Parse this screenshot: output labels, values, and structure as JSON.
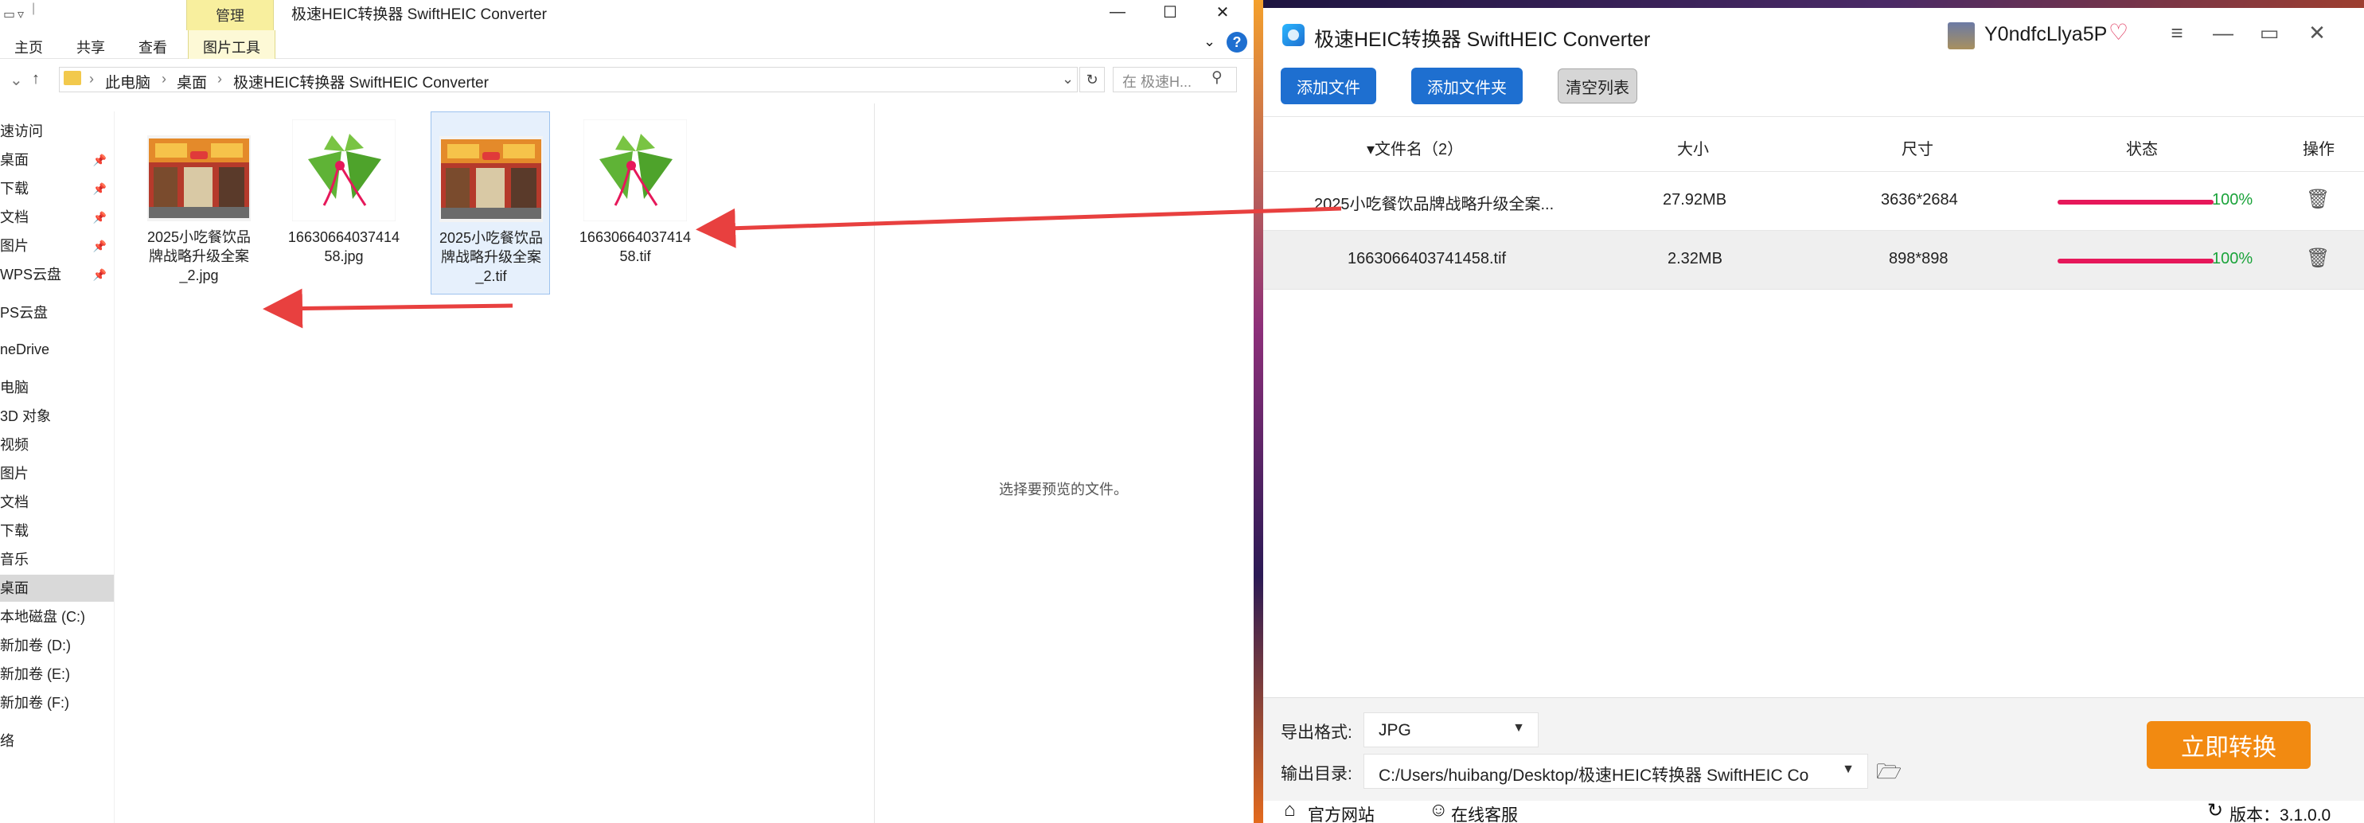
{
  "explorer": {
    "manage_tab": "管理",
    "window_title": "极速HEIC转换器 SwiftHEIC Converter",
    "ribbon_tabs": [
      "主页",
      "共享",
      "查看",
      "图片工具"
    ],
    "breadcrumbs": [
      "此电脑",
      "桌面",
      "极速HEIC转换器 SwiftHEIC Converter"
    ],
    "search_placeholder": "在 极速H...",
    "nav_items": [
      {
        "label": "速访问",
        "pinned": false
      },
      {
        "label": "桌面",
        "pinned": true
      },
      {
        "label": "下载",
        "pinned": true
      },
      {
        "label": "文档",
        "pinned": true
      },
      {
        "label": "图片",
        "pinned": true
      },
      {
        "label": "WPS云盘",
        "pinned": true
      },
      {
        "label": "PS云盘",
        "pinned": false
      },
      {
        "label": "neDrive",
        "pinned": false
      },
      {
        "label": "电脑",
        "pinned": false
      },
      {
        "label": "3D 对象",
        "pinned": false
      },
      {
        "label": "视频",
        "pinned": false
      },
      {
        "label": "图片",
        "pinned": false
      },
      {
        "label": "文档",
        "pinned": false
      },
      {
        "label": "下载",
        "pinned": false
      },
      {
        "label": "音乐",
        "pinned": false
      },
      {
        "label": "桌面",
        "pinned": false,
        "selected": true
      },
      {
        "label": "本地磁盘 (C:)",
        "pinned": false
      },
      {
        "label": "新加卷 (D:)",
        "pinned": false
      },
      {
        "label": "新加卷 (E:)",
        "pinned": false
      },
      {
        "label": "新加卷 (F:)",
        "pinned": false
      },
      {
        "label": "络",
        "pinned": false
      }
    ],
    "files": [
      {
        "name_lines": [
          "2025小吃餐饮品",
          "牌战略升级全案",
          "_2.jpg"
        ],
        "thumb": "storefront",
        "selected": false
      },
      {
        "name_lines": [
          "16630664037414",
          "58.jpg"
        ],
        "thumb": "zongzi",
        "selected": false
      },
      {
        "name_lines": [
          "2025小吃餐饮品",
          "牌战略升级全案",
          "_2.tif"
        ],
        "thumb": "storefront",
        "selected": true
      },
      {
        "name_lines": [
          "16630664037414",
          "58.tif"
        ],
        "thumb": "zongzi",
        "selected": false
      }
    ],
    "preview_text": "选择要预览的文件。"
  },
  "converter": {
    "title": "极速HEIC转换器 SwiftHEIC Converter",
    "username": "Y0ndfcLlya5P",
    "toolbar": {
      "add_file": "添加文件",
      "add_folder": "添加文件夹",
      "clear_list": "清空列表"
    },
    "columns": {
      "filename": "▾文件名（2）",
      "size": "大小",
      "dimensions": "尺寸",
      "status": "状态",
      "actions": "操作"
    },
    "rows": [
      {
        "filename": "2025小吃餐饮品牌战略升级全案...",
        "size": "27.92MB",
        "dimensions": "3636*2684",
        "progress": 1.0,
        "status_text": "100%"
      },
      {
        "filename": "1663066403741458.tif",
        "size": "2.32MB",
        "dimensions": "898*898",
        "progress": 1.0,
        "status_text": "100%"
      }
    ],
    "export_format_label": "导出格式:",
    "export_format_value": "JPG",
    "output_dir_label": "输出目录:",
    "output_dir_value": "C:/Users/huibang/Desktop/极速HEIC转换器 SwiftHEIC Co",
    "convert_button": "立即转换",
    "footer": {
      "website": "官方网站",
      "support": "在线客服",
      "version": "版本：3.1.0.0"
    },
    "colors": {
      "primary": "#1e6fd0",
      "convert": "#f28a11",
      "progress": "#e6185a",
      "percent": "#1aa33a",
      "arrow": "#e8403f"
    }
  }
}
